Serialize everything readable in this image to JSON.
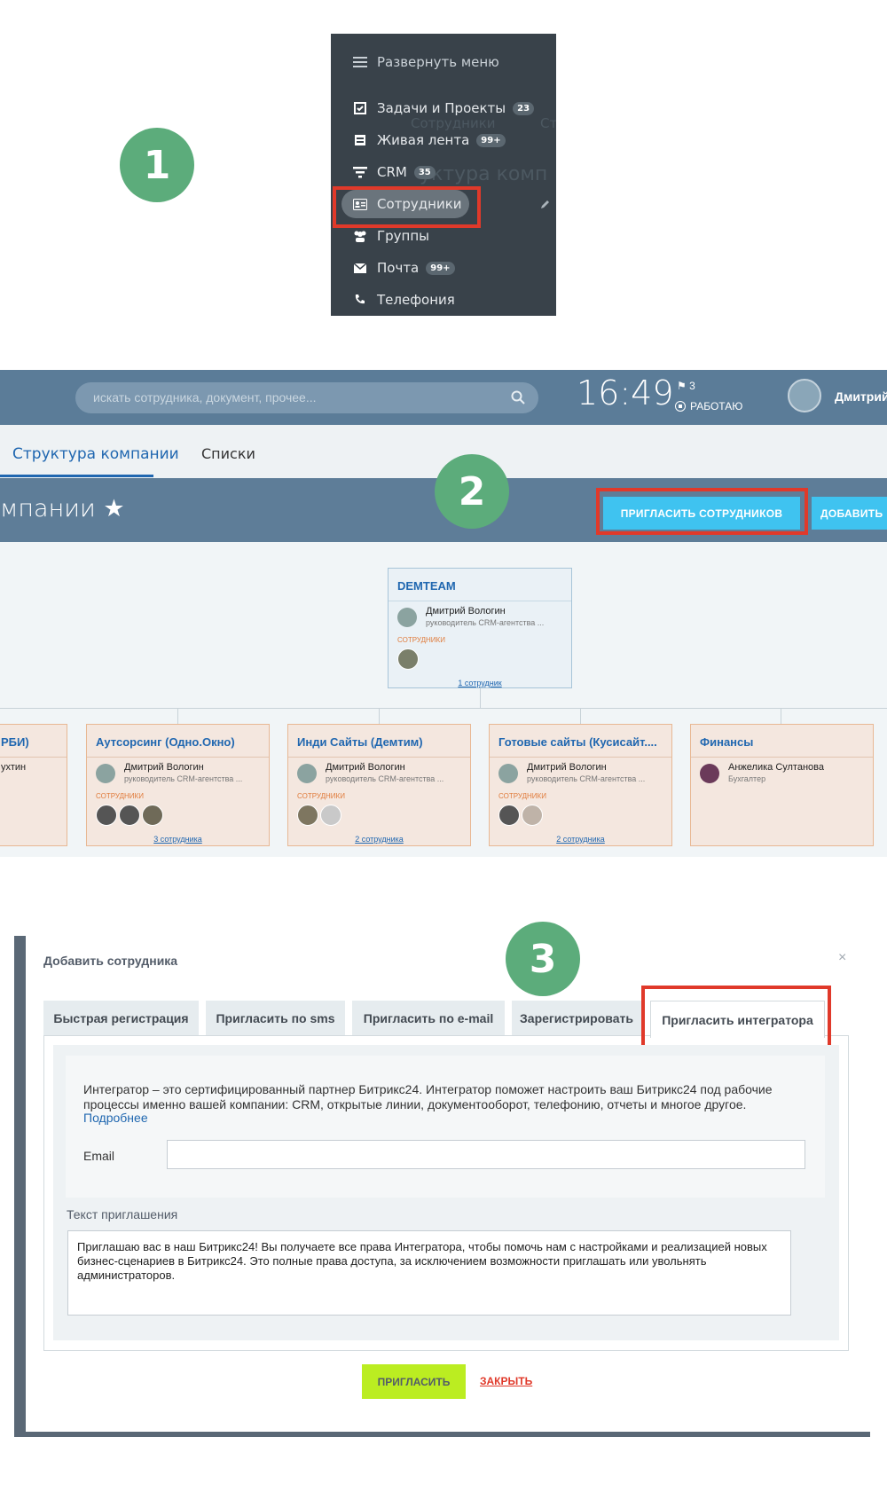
{
  "steps": [
    "1",
    "2",
    "3"
  ],
  "menu": {
    "expand_label": "Развернуть меню",
    "ghost_text_1": "Сотрудники",
    "ghost_text_2": "Ст",
    "ghost_text_3": "уктура комп",
    "items": [
      {
        "label": "Задачи и Проекты",
        "badge": "23",
        "icon": "tasks-icon"
      },
      {
        "label": "Живая лента",
        "badge": "99+",
        "icon": "feed-icon"
      },
      {
        "label": "CRM",
        "badge": "35",
        "icon": "crm-filter-icon"
      },
      {
        "label": "Сотрудники",
        "badge": "",
        "icon": "employees-card-icon",
        "active": true
      },
      {
        "label": "Группы",
        "badge": "",
        "icon": "groups-icon"
      },
      {
        "label": "Почта",
        "badge": "99+",
        "icon": "mail-icon"
      },
      {
        "label": "Телефония",
        "badge": "",
        "icon": "phone-icon"
      }
    ]
  },
  "portal": {
    "search_placeholder": "искать сотрудника, документ, прочее...",
    "clock": "16:49",
    "flag_count": "3",
    "status": "РАБОТАЮ",
    "user_name": "Дмитрий",
    "tabs": {
      "structure": "Структура компании",
      "lists": "Списки"
    },
    "page_title": "мпании ★",
    "invite_button": "ПРИГЛАСИТЬ СОТРУДНИКОВ",
    "add_button": "ДОБАВИТЬ"
  },
  "org": {
    "root": {
      "name": "DEMTEAM",
      "head": "Дмитрий Вологин",
      "role": "руководитель CRM-агентства ...",
      "employees_label": "СОТРУДНИКИ",
      "count": "1 сотрудник"
    },
    "partial_left": {
      "name": "РБИ)",
      "head": "ухтин"
    },
    "departments": [
      {
        "name": "Аутсорсинг (Одно.Окно)",
        "head": "Дмитрий Вологин",
        "role": "руководитель CRM-агентства ...",
        "employees_label": "СОТРУДНИКИ",
        "count": "3 сотрудника"
      },
      {
        "name": "Инди Сайты (Демтим)",
        "head": "Дмитрий Вологин",
        "role": "руководитель CRM-агентства ...",
        "employees_label": "СОТРУДНИКИ",
        "count": "2 сотрудника"
      },
      {
        "name": "Готовые сайты (Кусисайт....",
        "head": "Дмитрий Вологин",
        "role": "руководитель CRM-агентства ...",
        "employees_label": "СОТРУДНИКИ",
        "count": "2 сотрудника"
      },
      {
        "name": "Финансы",
        "head": "Анжелика Султанова",
        "role": "Бухгалтер"
      }
    ]
  },
  "dialog": {
    "title": "Добавить сотрудника",
    "close": "×",
    "tabs": [
      "Быстрая регистрация",
      "Пригласить по sms",
      "Пригласить по e-mail",
      "Зарегистрировать",
      "Пригласить интегратора"
    ],
    "info": "Интегратор – это сертифицированный партнер Битрикс24. Интегратор поможет настроить ваш Битрикс24 под рабочие процессы именно вашей компании: CRM, открытые линии, документооборот, телефонию, отчеты и многое другое.",
    "more_link": "Подробнее",
    "email_label": "Email",
    "email_value": "",
    "invite_label": "Текст приглашения",
    "invite_text": "Приглашаю вас в наш Битрикс24! Вы получаете все права Интегратора, чтобы помочь нам с настройками и реализацией новых бизнес-сценариев в Битрикс24. Это полные права доступа, за исключением возможности приглашать или увольнять администраторов.",
    "invite_button": "ПРИГЛАСИТЬ",
    "close_button": "ЗАКРЫТЬ"
  },
  "colors": {
    "step": "#5cac7b",
    "highlight": "#e0392a",
    "accent_blue": "#3fc3f0",
    "invite_green": "#bbed21"
  }
}
